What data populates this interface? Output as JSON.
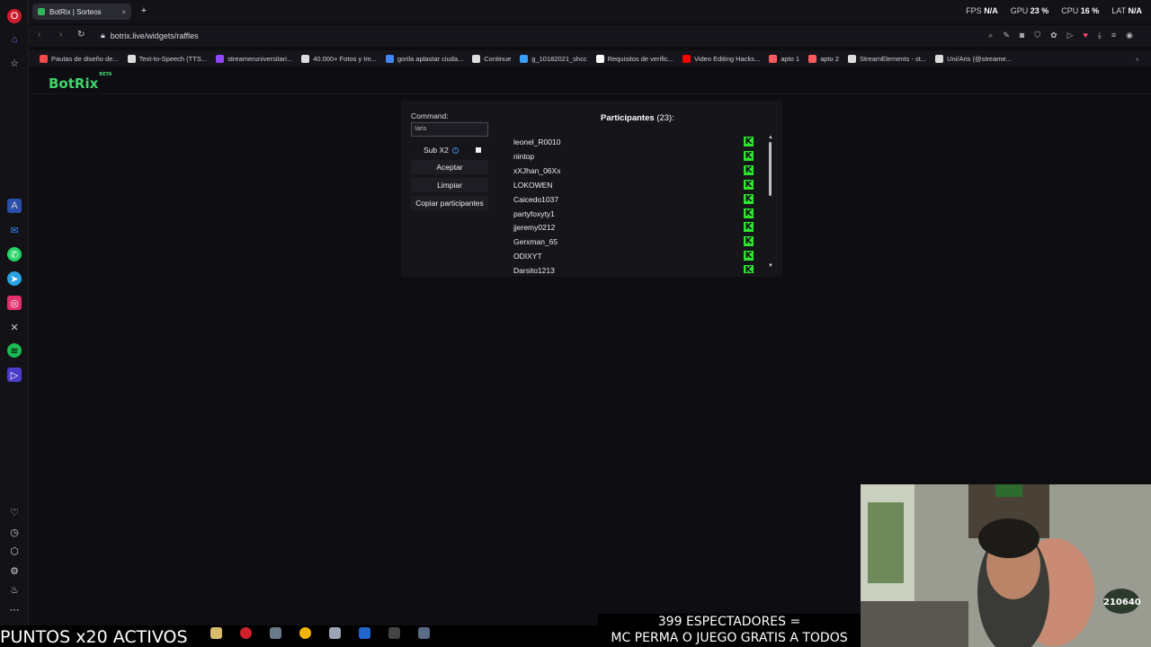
{
  "browser": {
    "tab_title": "BotRix | Sorteos",
    "url": "botrix.live/widgets/raffles",
    "stats": {
      "fps_label": "FPS",
      "fps_value": "N/A",
      "gpu_label": "GPU",
      "gpu_value": "23 %",
      "cpu_label": "CPU",
      "cpu_value": "16 %",
      "lat_label": "LAT",
      "lat_value": "N/A"
    },
    "bookmarks": [
      {
        "label": "Pautas de diseño de...",
        "color": "#f04a4a"
      },
      {
        "label": "Text-to-Speech (TTS...",
        "color": "#dddddd"
      },
      {
        "label": "streameruniversitari...",
        "color": "#9146ff"
      },
      {
        "label": "40.000+ Fotos y Im...",
        "color": "#dddddd"
      },
      {
        "label": "gorila aplastar ciuda...",
        "color": "#4285f4"
      },
      {
        "label": "Continue",
        "color": "#dddddd"
      },
      {
        "label": "g_10182021_shcc",
        "color": "#3aa0ff"
      },
      {
        "label": "Requisitos de verific...",
        "color": "#ffffff"
      },
      {
        "label": "Video Editing Hacks...",
        "color": "#ff0000"
      },
      {
        "label": "apto 1",
        "color": "#ff5a5f"
      },
      {
        "label": "apto 2",
        "color": "#ff5a5f"
      },
      {
        "label": "StreamElements - st...",
        "color": "#dddddd"
      },
      {
        "label": "Uni/Aris (@streame...",
        "color": "#dddddd"
      }
    ]
  },
  "page": {
    "logo": "BotRix",
    "logo_badge": "BETA",
    "command_label": "Command:",
    "command_value": "!aris",
    "sub_label": "Sub X2",
    "buttons": {
      "accept": "Aceptar",
      "clear": "Limpiar",
      "copy": "Copiar participantes"
    },
    "participants_label": "Participantes",
    "participants_count": "(23):",
    "participants": [
      "leonel_R0010",
      "nintop",
      "xXJhan_06Xx",
      "LOKOWEN",
      "Caicedo1037",
      "partyfoxyty1",
      "jjeremy0212",
      "Gerxman_65",
      "ODIXYT",
      "Darsito1213"
    ],
    "platform_badge": "K"
  },
  "overlay": {
    "points_text": "PUNTOS x20 ACTIVOS",
    "viewers_line1": "399 ESPECTADORES =",
    "viewers_line2": "MC PERMA O JUEGO GRATIS A TODOS",
    "webcam_counter": "210640"
  }
}
